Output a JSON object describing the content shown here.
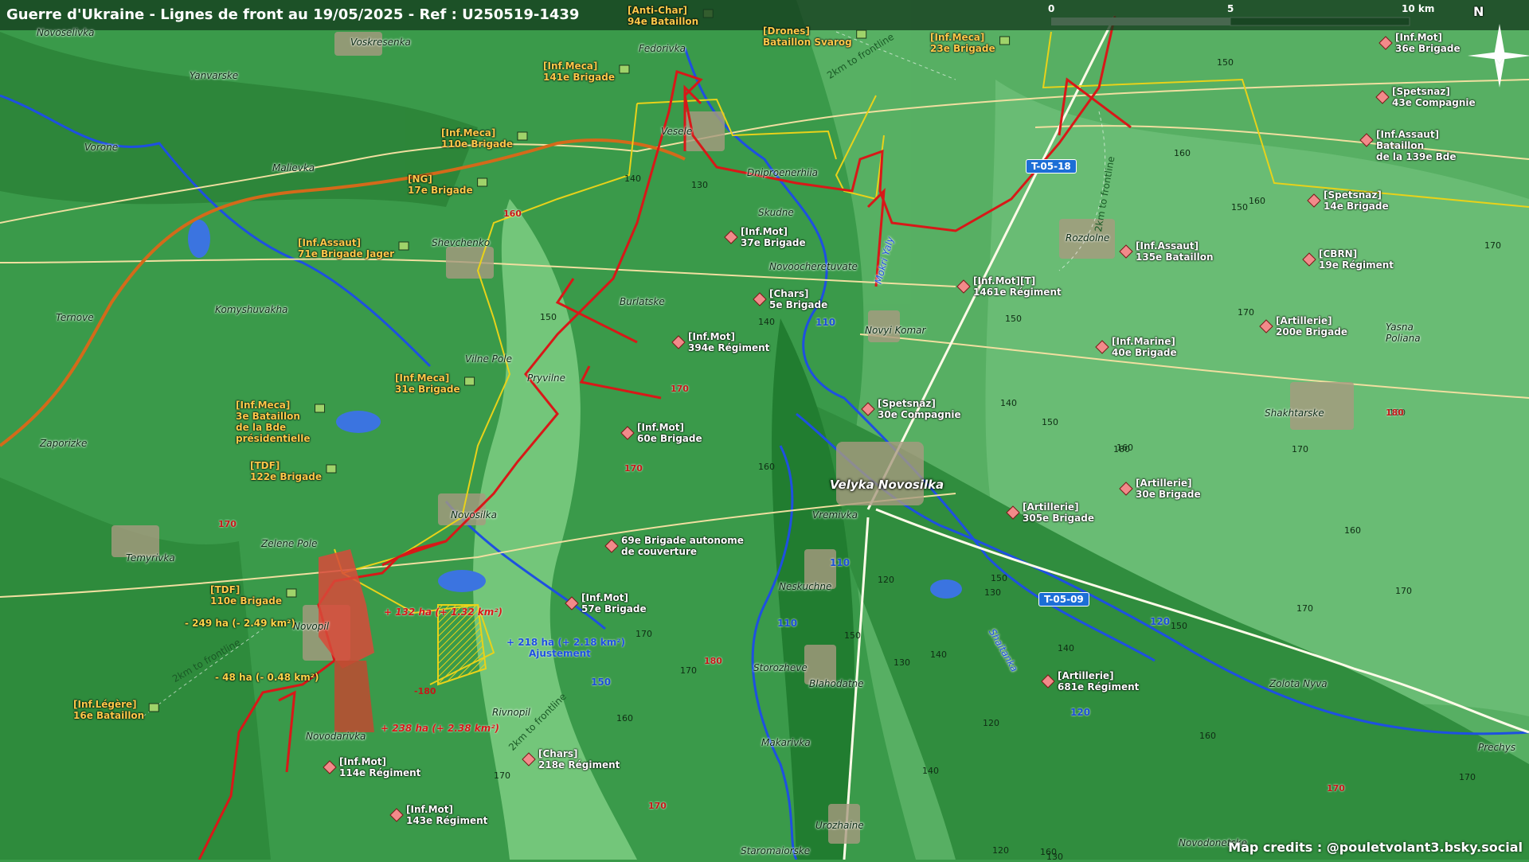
{
  "title": "Guerre d'Ukraine - Lignes de front au 19/05/2025 - Ref : U250519-1439",
  "credits": "Map credits : @pouletvolant3.bsky.social",
  "scale": {
    "labels": [
      "0",
      "5",
      "10 km"
    ]
  },
  "north_label": "N",
  "places": [
    {
      "id": "novoselivka",
      "name": "Novoselivka"
    },
    {
      "id": "voskresenka",
      "name": "Voskresenka"
    },
    {
      "id": "yanvarske",
      "name": "Yanvarske"
    },
    {
      "id": "vorone",
      "name": "Vorone"
    },
    {
      "id": "malievka",
      "name": "Malievka"
    },
    {
      "id": "ternove",
      "name": "Ternove"
    },
    {
      "id": "komyshuvakha",
      "name": "Komyshuvakha"
    },
    {
      "id": "shevchenko",
      "name": "Shevchenko"
    },
    {
      "id": "zaporizke",
      "name": "Zaporizke"
    },
    {
      "id": "fedorivka",
      "name": "Fedorivka"
    },
    {
      "id": "vesele",
      "name": "Vesele"
    },
    {
      "id": "dniproenerhiia",
      "name": "Dniproenerhiia"
    },
    {
      "id": "skudne",
      "name": "Skudne"
    },
    {
      "id": "novoocheretuvate",
      "name": "Novoocheretuvate"
    },
    {
      "id": "burlatske",
      "name": "Burlatske"
    },
    {
      "id": "vilne-pole",
      "name": "Vilne Pole"
    },
    {
      "id": "pryvilne",
      "name": "Pryvilne"
    },
    {
      "id": "novyi-komar",
      "name": "Novyi Komar"
    },
    {
      "id": "mokri-yaly",
      "name": "Mokri Yaly"
    },
    {
      "id": "rozdolne",
      "name": "Rozdolne"
    },
    {
      "id": "yasna-poliana",
      "name": "Yasna Poliana"
    },
    {
      "id": "shakhtarske",
      "name": "Shakhtarske"
    },
    {
      "id": "velyka-novosilka",
      "name": "Velyka Novosilka"
    },
    {
      "id": "vremivka",
      "name": "Vremivka"
    },
    {
      "id": "novosilka",
      "name": "Novosilka"
    },
    {
      "id": "zelene-pole",
      "name": "Zelene Pole"
    },
    {
      "id": "temyrivka",
      "name": "Temyrivka"
    },
    {
      "id": "novopil",
      "name": "Novopil"
    },
    {
      "id": "neskuchne",
      "name": "Neskuchne"
    },
    {
      "id": "storozheve",
      "name": "Storozheve"
    },
    {
      "id": "blahodatne",
      "name": "Blahodatne"
    },
    {
      "id": "rivnopil",
      "name": "Rivnopil"
    },
    {
      "id": "novodarivka",
      "name": "Novodarivka"
    },
    {
      "id": "makarivka",
      "name": "Makarivka"
    },
    {
      "id": "urozhaine",
      "name": "Urozhaine"
    },
    {
      "id": "staromaiorske",
      "name": "Staromaiorske"
    },
    {
      "id": "zolota-nyva",
      "name": "Zolota Nyva"
    },
    {
      "id": "novodonetske",
      "name": "Novodonetske"
    },
    {
      "id": "prechys",
      "name": "Prechys"
    },
    {
      "id": "shaitanka",
      "name": "Shaitanka"
    }
  ],
  "ua_units": [
    {
      "id": "u1",
      "line1": "[Anti-Char]",
      "line2": "94e Bataillon"
    },
    {
      "id": "u2",
      "line1": "[Drones]",
      "line2": "Bataillon Svarog"
    },
    {
      "id": "u3",
      "line1": "[Inf.Meca]",
      "line2": "23e Brigade"
    },
    {
      "id": "u4",
      "line1": "[Inf.Meca]",
      "line2": "141e Brigade"
    },
    {
      "id": "u5",
      "line1": "[Inf.Meca]",
      "line2": "110e Brigade"
    },
    {
      "id": "u6",
      "line1": "[NG]",
      "line2": "17e Brigade"
    },
    {
      "id": "u7",
      "line1": "[Inf.Assaut]",
      "line2": "71e Brigade Jager"
    },
    {
      "id": "u8",
      "line1": "[Inf.Meca]",
      "line2": "31e Brigade"
    },
    {
      "id": "u9",
      "line1": "[Inf.Meca]",
      "line2": "3e Bataillon",
      "line3": "de la Bde",
      "line4": "présidentielle"
    },
    {
      "id": "u10",
      "line1": "[TDF]",
      "line2": "122e Brigade"
    },
    {
      "id": "u11",
      "line1": "[TDF]",
      "line2": "110e Brigade"
    },
    {
      "id": "u12",
      "line1": "[Inf.Légère]",
      "line2": "16e Bataillon"
    }
  ],
  "ru_units": [
    {
      "id": "r1",
      "line1": "[Inf.Mot]",
      "line2": "36e Brigade"
    },
    {
      "id": "r2",
      "line1": "[Spetsnaz]",
      "line2": "43e Compagnie"
    },
    {
      "id": "r3",
      "line1": "[Inf.Assaut]",
      "line2": "Bataillon",
      "line3": "de la 139e Bde"
    },
    {
      "id": "r4",
      "line1": "[Spetsnaz]",
      "line2": "14e Brigade"
    },
    {
      "id": "r5",
      "line1": "[Inf.Mot]",
      "line2": "37e Brigade"
    },
    {
      "id": "r6",
      "line1": "[Inf.Assaut]",
      "line2": "135e Bataillon"
    },
    {
      "id": "r7",
      "line1": "[CBRN]",
      "line2": "19e Régiment"
    },
    {
      "id": "r8",
      "line1": "[Chars]",
      "line2": "5e Brigade"
    },
    {
      "id": "r9",
      "line1": "[Inf.Mot][T]",
      "line2": "1461e Régiment"
    },
    {
      "id": "r10",
      "line1": "[Artillerie]",
      "line2": "200e Brigade"
    },
    {
      "id": "r11",
      "line1": "[Inf.Mot]",
      "line2": "394e Régiment"
    },
    {
      "id": "r12",
      "line1": "[Inf.Marine]",
      "line2": "40e Brigade"
    },
    {
      "id": "r13",
      "line1": "[Spetsnaz]",
      "line2": "30e Compagnie"
    },
    {
      "id": "r14",
      "line1": "[Inf.Mot]",
      "line2": "60e Brigade"
    },
    {
      "id": "r15",
      "line1": "[Artillerie]",
      "line2": "30e Brigade"
    },
    {
      "id": "r16",
      "line1": "[Artillerie]",
      "line2": "305e Brigade"
    },
    {
      "id": "r17",
      "line1": "69e Brigade autonome",
      "line2": "de couverture"
    },
    {
      "id": "r18",
      "line1": "[Inf.Mot]",
      "line2": "57e Brigade"
    },
    {
      "id": "r19",
      "line1": "[Artillerie]",
      "line2": "681e Régiment"
    },
    {
      "id": "r20",
      "line1": "[Chars]",
      "line2": "218e Régiment"
    },
    {
      "id": "r21",
      "line1": "[Inf.Mot]",
      "line2": "114e Régiment"
    },
    {
      "id": "r22",
      "line1": "[Inf.Mot]",
      "line2": "143e Régiment"
    }
  ],
  "elevations": [
    "150",
    "160",
    "140",
    "130",
    "160",
    "150",
    "170",
    "150",
    "140",
    "170",
    "150",
    "150",
    "180",
    "160",
    "140",
    "160",
    "170",
    "160",
    "150",
    "170",
    "140",
    "130",
    "140",
    "120",
    "130",
    "120",
    "140",
    "130",
    "120",
    "150",
    "170",
    "180",
    "170",
    "170",
    "160",
    "170",
    "150",
    "170",
    "160",
    "-180",
    "160"
  ],
  "elevations_red": [
    "160",
    "170",
    "170",
    "170",
    "180",
    "180",
    "-180",
    "170",
    "170"
  ],
  "roads": {
    "t0518": "T-05-18",
    "t0509": "T-05-09",
    "r110a": "110",
    "r110b": "110",
    "r110c": "110",
    "r120a": "120",
    "r120b": "120",
    "r150": "150"
  },
  "annotations": {
    "gain1": "+ 132 ha (+ 1.32 km²)",
    "gain2": "+ 238 ha (+ 2.38 km²)",
    "adjust1": "+ 218 ha (+ 2.18 km²)",
    "adjust2": "Ajustement",
    "loss1": "- 249 ha (- 2.49 km²)",
    "loss2": "- 48 ha (- 0.48 km²)"
  },
  "front_labels": [
    "2km to frontline",
    "2km to frontline",
    "2km to frontline",
    "2km to frontline"
  ],
  "colors": {
    "russian": "#d81818",
    "ukrainian": "#ffc94a",
    "front_yellow": "#e8d21a",
    "road": "#f0dfa0",
    "river": "#1e50e0",
    "terrain": "#3a9a4a"
  }
}
